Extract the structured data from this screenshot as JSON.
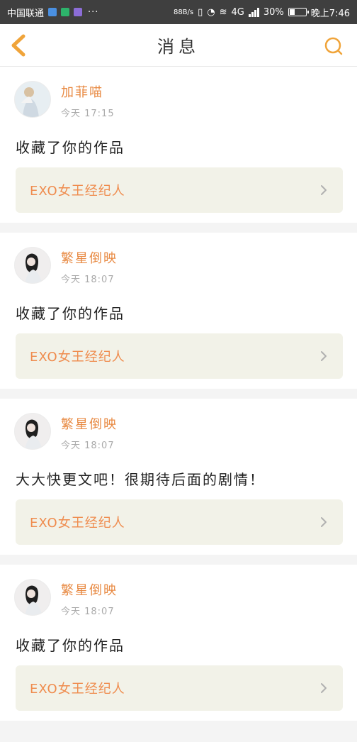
{
  "status_bar": {
    "carrier": "中国联通",
    "network_speed": "88B/s",
    "signal_type": "4G",
    "battery_percent": "30%",
    "time": "晚上7:46"
  },
  "header": {
    "title": "消息"
  },
  "messages": [
    {
      "user": "加菲喵",
      "time": "今天 17:15",
      "text": "收藏了你的作品",
      "work_title": "EXO女王经纪人"
    },
    {
      "user": "繁星倒映",
      "time": "今天 18:07",
      "text": "收藏了你的作品",
      "work_title": "EXO女王经纪人"
    },
    {
      "user": "繁星倒映",
      "time": "今天 18:07",
      "text": "大大快更文吧！很期待后面的剧情！",
      "work_title": "EXO女王经纪人"
    },
    {
      "user": "繁星倒映",
      "time": "今天 18:07",
      "text": "收藏了你的作品",
      "work_title": "EXO女王经纪人"
    }
  ],
  "colors": {
    "accent": "#e88a43",
    "nav_icon": "#f0a43a",
    "background": "#f4f4f4",
    "link_card": "#f2f2e8"
  },
  "icons": {
    "back": "chevron-left-icon",
    "search": "search-icon",
    "link": "chevron-right-icon",
    "status": [
      "shield-icon",
      "shield-check-icon",
      "app-icon",
      "vibrate-icon",
      "alarm-icon",
      "wifi-icon",
      "signal-icon",
      "battery-icon"
    ]
  }
}
